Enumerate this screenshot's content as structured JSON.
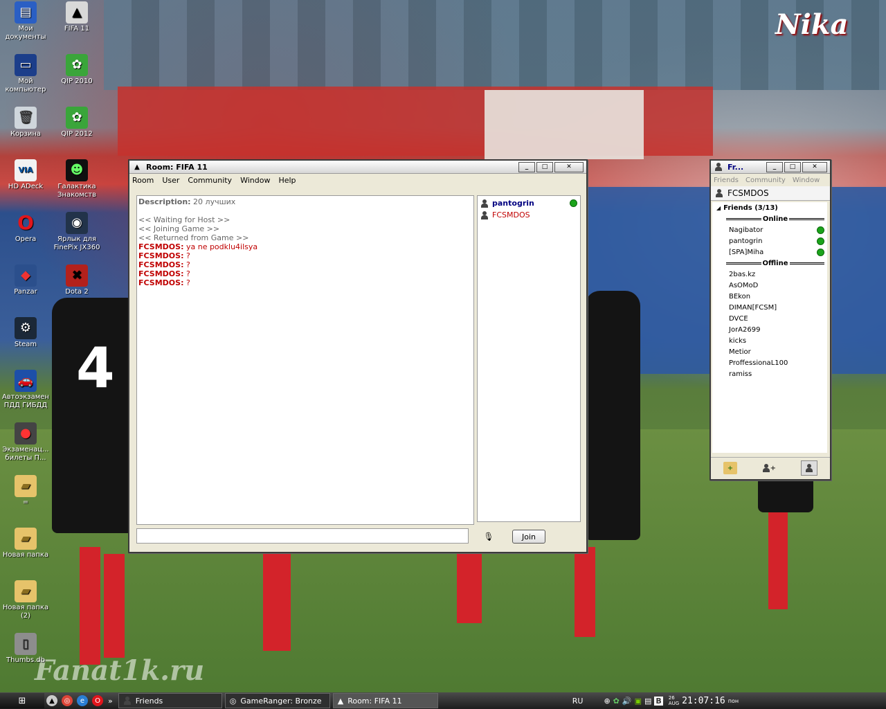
{
  "desktop": {
    "watermark_top": "Nika",
    "watermark_bottom": "Fanat1k.ru",
    "icons": [
      {
        "label": "Мои документы"
      },
      {
        "label": "FIFA 11"
      },
      {
        "label": "Мой компьютер"
      },
      {
        "label": "QIP 2010"
      },
      {
        "label": "Корзина"
      },
      {
        "label": "QIP 2012"
      },
      {
        "label": "HD ADeck"
      },
      {
        "label": "Галактика Знакомств"
      },
      {
        "label": "Opera"
      },
      {
        "label": "Ярлык для FinePix JX360"
      },
      {
        "label": "Panzar"
      },
      {
        "label": "Dota 2"
      },
      {
        "label": "Steam"
      },
      {
        "label": "Автоэкзамен ПДД ГИБДД"
      },
      {
        "label": "Экзаменац... билеты П..."
      },
      {
        "label": "="
      },
      {
        "label": "Новая папка"
      },
      {
        "label": "Новая папка (2)"
      },
      {
        "label": "Thumbs.db"
      }
    ]
  },
  "room_window": {
    "title": "Room: FIFA 11",
    "menu": [
      "Room",
      "User",
      "Community",
      "Window",
      "Help"
    ],
    "description_label": "Description:",
    "description_value": "20 лучших",
    "chat": [
      {
        "type": "system",
        "text": "<< Waiting for Host >>"
      },
      {
        "type": "system",
        "text": "<< Joining Game >>"
      },
      {
        "type": "system",
        "text": "<< Returned from Game >>"
      },
      {
        "type": "msg",
        "nick": "FCSMDOS:",
        "text": "ya ne podklu4ilsya"
      },
      {
        "type": "msg",
        "nick": "FCSMDOS:",
        "text": "?"
      },
      {
        "type": "msg",
        "nick": "FCSMDOS:",
        "text": "?"
      },
      {
        "type": "msg",
        "nick": "FCSMDOS:",
        "text": "?"
      },
      {
        "type": "msg",
        "nick": "FCSMDOS:",
        "text": "?"
      }
    ],
    "users": [
      {
        "name": "pantogrin",
        "host": true,
        "online": true
      },
      {
        "name": "FCSMDOS",
        "host": false,
        "online": false
      }
    ],
    "chat_input_value": "",
    "join_label": "Join",
    "colors": {
      "host_user": "#000080",
      "other_user": "#c00000",
      "nick": "#c00000"
    }
  },
  "friends_window": {
    "title": "Fr...",
    "menu": [
      "Friends",
      "Community",
      "Window"
    ],
    "account": "FCSMDOS",
    "group_label": "Friends (3/13)",
    "online_label": "Online",
    "offline_label": "Offline",
    "online": [
      "Nagibator",
      "pantogrin",
      "[SPA]Miha"
    ],
    "offline": [
      "2bas.kz",
      "AsOMoD",
      "BEkon",
      "DIMAN[FCSM]",
      "DVCE",
      "JorA2699",
      "kicks",
      "Metior",
      "ProffessionaL100",
      "ramiss"
    ]
  },
  "taskbar": {
    "tasks": [
      "Friends",
      "GameRanger: Bronze",
      "Room: FIFA 11"
    ],
    "lang": "RU",
    "clock": "21:07:16",
    "date_day": "26",
    "date_month": "AUG",
    "weekday": "пон"
  }
}
